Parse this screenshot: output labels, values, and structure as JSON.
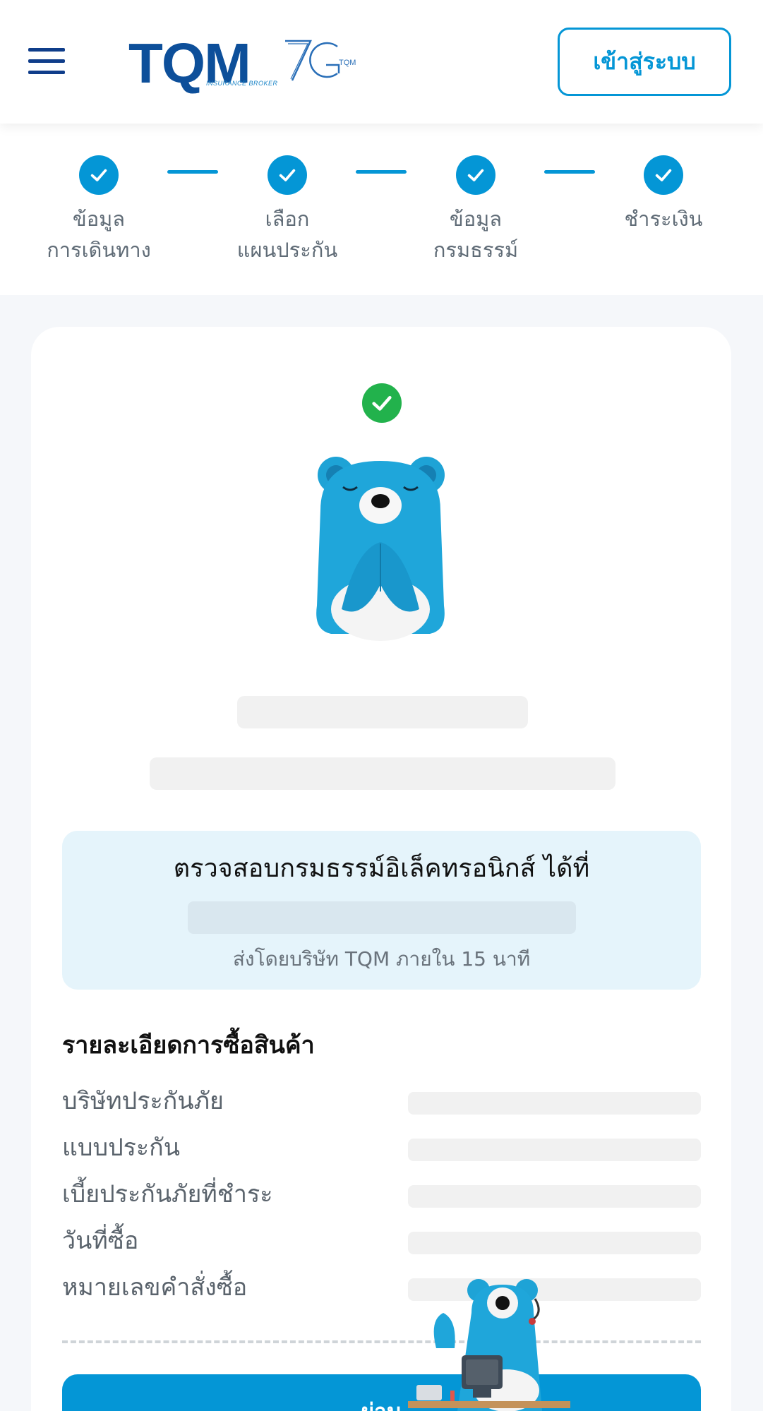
{
  "header": {
    "logo_text": "TQM",
    "logo_tagline": "INSURANCE BROKER",
    "anniversary_text": "TQM",
    "login_label": "เข้าสู่ระบบ"
  },
  "stepper": {
    "steps": [
      {
        "line1": "ข้อมูล",
        "line2": "การเดินทาง"
      },
      {
        "line1": "เลือก",
        "line2": "แผนประกัน"
      },
      {
        "line1": "ข้อมูล",
        "line2": "กรมธรรม์"
      },
      {
        "line1": "ชำระเงิน",
        "line2": ""
      }
    ]
  },
  "policy_box": {
    "title": "ตรวจสอบกรมธรรม์อิเล็คทรอนิกส์ ได้ที่",
    "note": "ส่งโดยบริษัท TQM ภายใน 15 นาที"
  },
  "purchase_details": {
    "title": "รายละเอียดการซื้อสินค้า",
    "rows": [
      {
        "label": "บริษัทประกันภัย"
      },
      {
        "label": "แบบประกัน"
      },
      {
        "label": "เบี้ยประกันภัยที่ชำระ"
      },
      {
        "label": "วันที่ซื้อ"
      },
      {
        "label": "หมายเลขคำสั่งซื้อ"
      }
    ]
  },
  "cta": {
    "label": "ผ่าน"
  },
  "colors": {
    "primary": "#0496d6",
    "brand_navy": "#0f3d8a",
    "success": "#22b24c",
    "info_bg": "#e5f4fb"
  }
}
